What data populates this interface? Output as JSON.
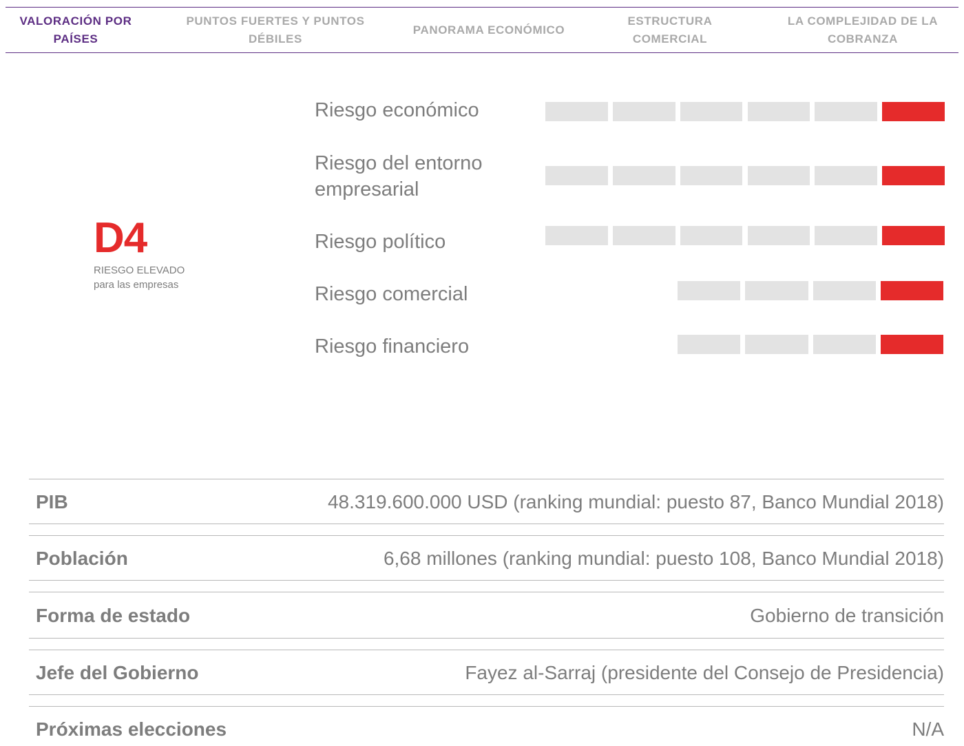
{
  "tabs": [
    {
      "label": "VALORACIÓN POR PAÍSES",
      "lines": [
        "VALORACIÓN POR",
        "PAÍSES"
      ]
    },
    {
      "label": "PUNTOS FUERTES Y PUNTOS DÉBILES",
      "lines": [
        "PUNTOS FUERTES Y PUNTOS",
        "DÉBILES"
      ]
    },
    {
      "label": "PANORAMA ECONÓMICO",
      "lines": [
        "PANORAMA ECONÓMICO",
        ""
      ]
    },
    {
      "label": "ESTRUCTURA COMERCIAL",
      "lines": [
        "ESTRUCTURA",
        "COMERCIAL"
      ]
    },
    {
      "label": "LA COMPLEJIDAD DE LA COBRANZA",
      "lines": [
        "LA COMPLEJIDAD DE LA",
        "COBRANZA"
      ]
    }
  ],
  "active_tab": 0,
  "rating": {
    "grade": "D4",
    "title": "RIESGO ELEVADO",
    "subtitle": "para las empresas"
  },
  "risks": [
    {
      "label_lines": [
        "Riesgo económico"
      ],
      "level": 6,
      "max": 6
    },
    {
      "label_lines": [
        "Riesgo del entorno",
        "empresarial"
      ],
      "level": 6,
      "max": 6
    },
    {
      "label_lines": [
        "Riesgo político"
      ],
      "level": 6,
      "max": 6
    },
    {
      "label_lines": [
        "Riesgo comercial"
      ],
      "level": 4,
      "max": 4
    },
    {
      "label_lines": [
        "Riesgo financiero"
      ],
      "level": 4,
      "max": 4
    }
  ],
  "colors": {
    "accent": "#5c2d83",
    "risk_on": "#e52b2b",
    "risk_off": "#e3e3e3",
    "text": "#7d7d7d"
  },
  "facts": [
    {
      "label": "PIB",
      "value": "48.319.600.000 USD (ranking mundial: puesto 87, Banco Mundial 2018)"
    },
    {
      "label": "Población",
      "value": "6,68 millones (ranking mundial: puesto 108, Banco Mundial 2018)"
    },
    {
      "label": "Forma de estado",
      "value": "Gobierno de transición"
    },
    {
      "label": "Jefe del Gobierno",
      "value": "Fayez al-Sarraj (presidente del Consejo de Presidencia)"
    },
    {
      "label": "Próximas elecciones",
      "value": "N/A"
    }
  ]
}
